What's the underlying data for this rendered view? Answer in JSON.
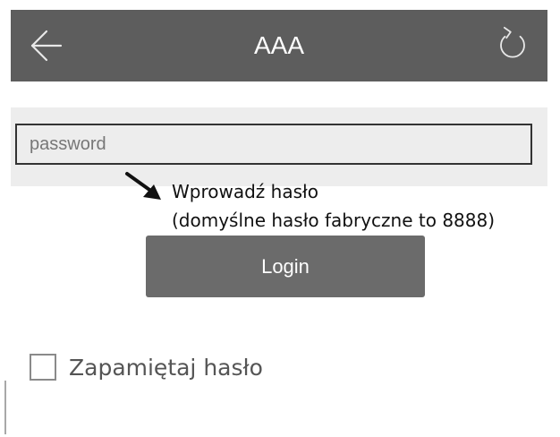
{
  "header": {
    "title": "AAA",
    "back_icon": "arrow-left-icon",
    "refresh_icon": "refresh-icon"
  },
  "login_form": {
    "password_placeholder": "password",
    "login_label": "Login",
    "remember_label": "Zapamiętaj hasło",
    "remember_checked": false
  },
  "annotation": {
    "line1": "Wprowadź hasło",
    "line2": "(domyślne hasło fabryczne to 8888)"
  },
  "colors": {
    "header_bg": "#5d5d5d",
    "form_band_bg": "#ededed",
    "button_bg": "#6b6b6b"
  }
}
